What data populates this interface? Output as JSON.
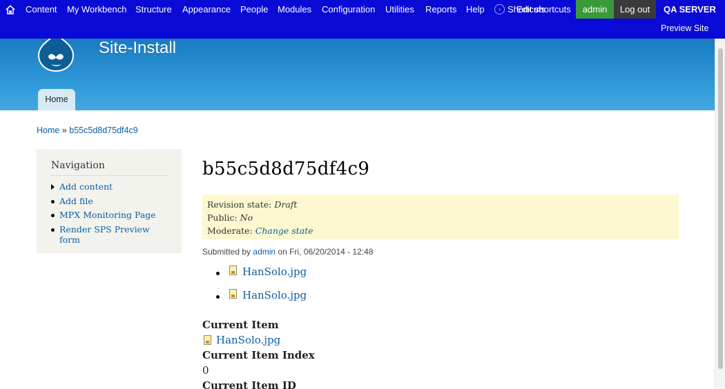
{
  "toolbar": {
    "menu": [
      "Content",
      "My Workbench",
      "Structure",
      "Appearance",
      "People",
      "Modules",
      "Configuration",
      "Utilities",
      "Reports",
      "Help"
    ],
    "shortcuts_label": "Shortcuts",
    "edit_shortcuts": "Edit shortcuts",
    "user": "admin",
    "logout": "Log out",
    "server": "QA SERVER",
    "preview": "Preview Site",
    "colors": {
      "bar": "#0a0ad6",
      "user": "#3a9a3a",
      "logout": "#3a3a3a"
    },
    "icons": {
      "home": "home-icon",
      "toggle": "shortcut-toggle-icon"
    }
  },
  "header": {
    "site_name": "Site-Install",
    "tab_home": "Home",
    "logo_icon": "drupal-logo-icon"
  },
  "breadcrumb": {
    "home": "Home",
    "separator": "»",
    "current": "b55c5d8d75df4c9"
  },
  "sidebar": {
    "title": "Navigation",
    "items": [
      {
        "label": "Add content",
        "marker": "arrow"
      },
      {
        "label": "Add file",
        "marker": "dot"
      },
      {
        "label": "MPX Monitoring Page",
        "marker": "dot"
      },
      {
        "label": "Render SPS Preview form",
        "marker": "dot"
      }
    ]
  },
  "main": {
    "title": "b55c5d8d75df4c9",
    "workbench": {
      "revision_label": "Revision state:",
      "revision_value": "Draft",
      "public_label": "Public:",
      "public_value": "No",
      "moderate_label": "Moderate:",
      "moderate_link": "Change state"
    },
    "submitted": {
      "prefix": "Submitted by",
      "user": "admin",
      "suffix": "on Fri, 06/20/2014 - 12:48"
    },
    "files": [
      "HanSolo.jpg",
      "HanSolo.jpg"
    ],
    "fields": {
      "current_item_label": "Current Item",
      "current_item_value": "HanSolo.jpg",
      "current_index_label": "Current Item Index",
      "current_index_value": "0",
      "current_id_label": "Current Item ID"
    }
  }
}
